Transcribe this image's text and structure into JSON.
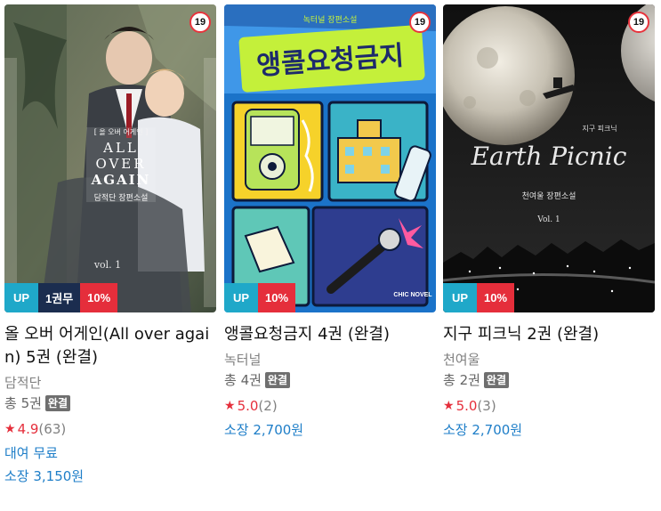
{
  "books": [
    {
      "cover_text": {
        "series_tag": "[ 올 오버 어게인 ]",
        "title_lines": [
          "ALL",
          "OVER",
          "AGAIN"
        ],
        "byline": "담적단 장편소설",
        "vol": "vol. 1"
      },
      "age_rating": "19",
      "tags": {
        "up": "UP",
        "free": "1권무",
        "discount": "10%"
      },
      "title": "올 오버 어게인(All over again) 5권 (완결)",
      "author": "담적단",
      "volumes": "총 5권",
      "complete": "완결",
      "rating": {
        "score": "4.9",
        "count": "(63)"
      },
      "rent": "대여 무료",
      "buy": "소장 3,150원"
    },
    {
      "cover_text": {
        "kicker": "녹터널 장편소설",
        "title": "앵콜요청금지",
        "label": "CHIC NOVEL"
      },
      "age_rating": "19",
      "tags": {
        "up": "UP",
        "discount": "10%"
      },
      "title": "앵콜요청금지 4권 (완결)",
      "author": "녹터널",
      "volumes": "총 4권",
      "complete": "완결",
      "rating": {
        "score": "5.0",
        "count": "(2)"
      },
      "buy": "소장 2,700원"
    },
    {
      "cover_text": {
        "title": "Earth Picnic",
        "sub": "지구 피크닉",
        "byline": "천여울 장편소설",
        "vol": "Vol. 1"
      },
      "age_rating": "19",
      "tags": {
        "up": "UP",
        "discount": "10%"
      },
      "title": "지구 피크닉 2권 (완결)",
      "author": "천여울",
      "volumes": "총 2권",
      "complete": "완결",
      "rating": {
        "score": "5.0",
        "count": "(3)"
      },
      "buy": "소장 2,700원"
    }
  ],
  "colors": {
    "up_tag": "#1fa8c9",
    "free_tag": "#1b2d4f",
    "discount_tag": "#e52e3b",
    "star": "#e52e3b",
    "price": "#1e7ec8"
  },
  "icons": {
    "rating": "star-icon"
  }
}
